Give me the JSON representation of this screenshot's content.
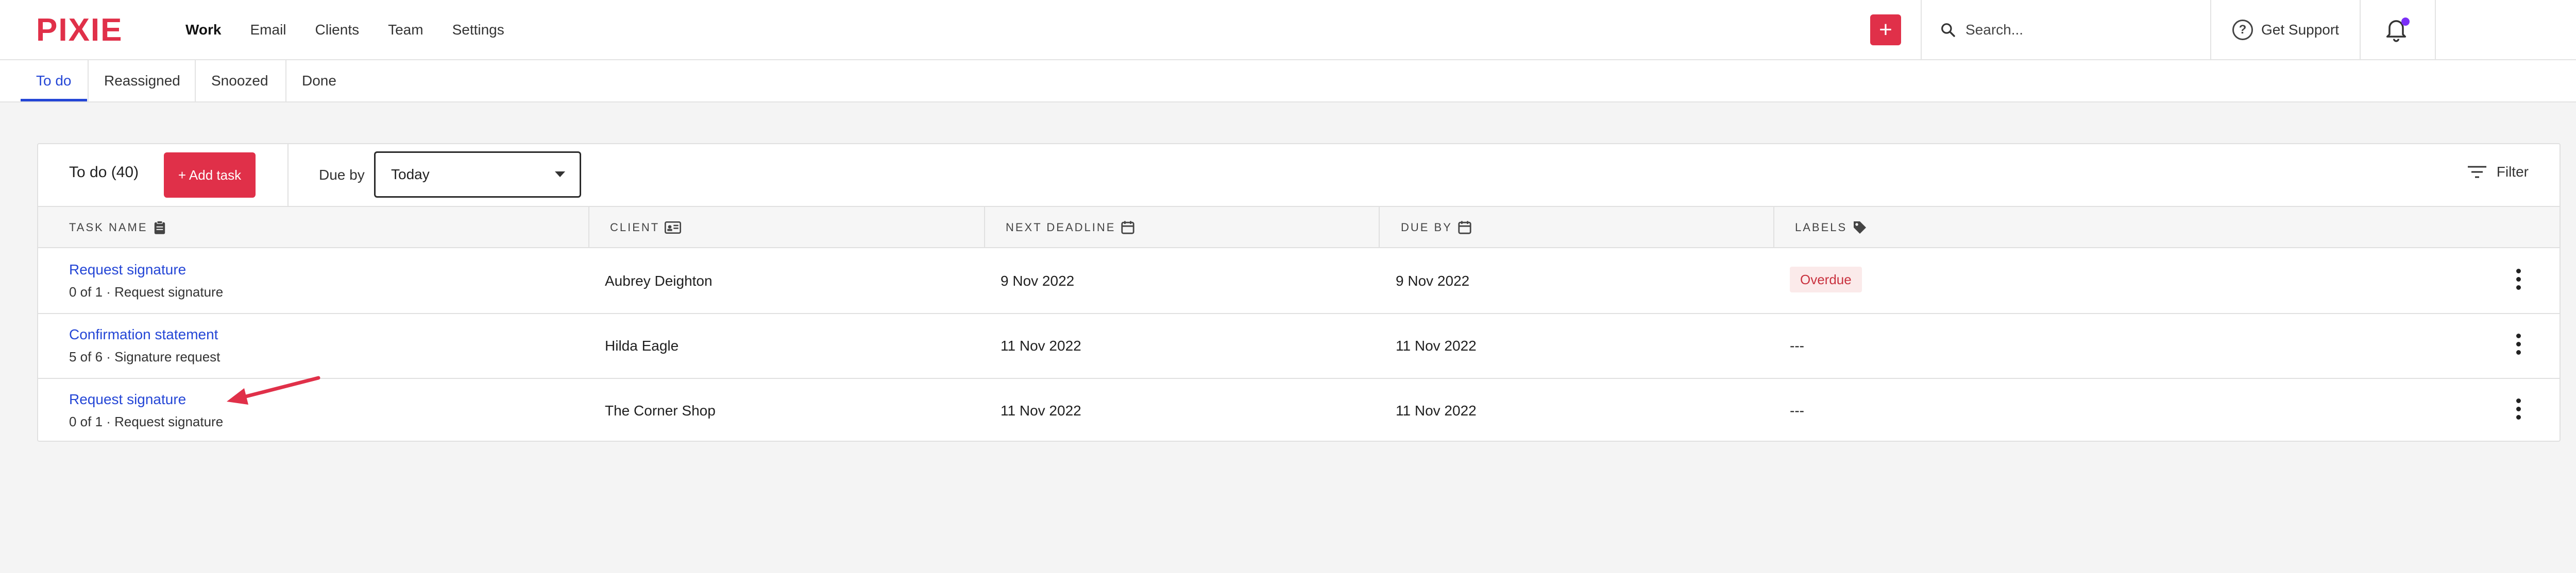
{
  "app": {
    "logo": "PIXIE",
    "brand_color": "#e03049",
    "link_color": "#2446d6"
  },
  "nav": {
    "items": [
      {
        "label": "Work",
        "active": true
      },
      {
        "label": "Email"
      },
      {
        "label": "Clients"
      },
      {
        "label": "Team"
      },
      {
        "label": "Settings"
      }
    ]
  },
  "topbar": {
    "add_label": "+",
    "search_placeholder": "Search...",
    "support_label": "Get Support",
    "support_icon": "?",
    "notification_dot_color": "#7b2ff7"
  },
  "subtabs": [
    {
      "label": "To do",
      "active": true
    },
    {
      "label": "Reassigned"
    },
    {
      "label": "Snoozed"
    },
    {
      "label": "Done"
    }
  ],
  "card": {
    "title": "To do (40)",
    "add_task_label": "+ Add task",
    "due_by_label": "Due by",
    "due_by_value": "Today",
    "filter_label": "Filter"
  },
  "table": {
    "columns": [
      "TASK NAME",
      "CLIENT",
      "NEXT DEADLINE",
      "DUE BY",
      "LABELS"
    ],
    "rows": [
      {
        "task": "Request signature",
        "sub": "0 of 1 · Request signature",
        "client": "Aubrey Deighton",
        "deadline": "9 Nov 2022",
        "due": "9 Nov 2022",
        "label": "Overdue"
      },
      {
        "task": "Confirmation statement",
        "sub": "5 of 6 · Signature request",
        "client": "Hilda Eagle",
        "deadline": "11 Nov 2022",
        "due": "11 Nov 2022",
        "label": "---"
      },
      {
        "task": "Request signature",
        "sub": "0 of 1 · Request signature",
        "client": "The Corner Shop",
        "deadline": "11 Nov 2022",
        "due": "11 Nov 2022",
        "label": "---"
      }
    ]
  }
}
